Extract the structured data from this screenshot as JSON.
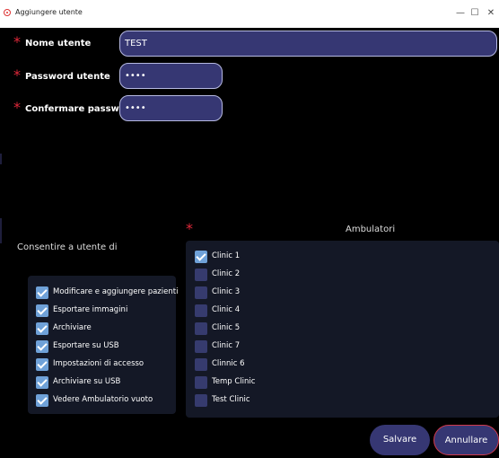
{
  "window": {
    "title": "Aggiungere utente",
    "minimize": "—",
    "maximize": "☐",
    "close": "✕"
  },
  "required_mark": "*",
  "form": {
    "username": {
      "label": "Nome utente",
      "value": "TEST"
    },
    "password": {
      "label": "Password utente",
      "value": "••••"
    },
    "confirm": {
      "label": "Confermare password",
      "value": "••••"
    }
  },
  "permissions": {
    "heading": "Consentire a utente di",
    "items": [
      {
        "label": "Modificare e aggiungere pazienti",
        "checked": true
      },
      {
        "label": "Esportare immagini",
        "checked": true
      },
      {
        "label": "Archiviare",
        "checked": true
      },
      {
        "label": "Esportare su USB",
        "checked": true
      },
      {
        "label": "Impostazioni di accesso",
        "checked": true
      },
      {
        "label": "Archiviare su USB",
        "checked": true
      },
      {
        "label": "Vedere Ambulatorio vuoto",
        "checked": true
      }
    ]
  },
  "clinics": {
    "heading": "Ambulatori",
    "items": [
      {
        "label": "Clinic 1",
        "checked": true
      },
      {
        "label": "Clinic 2",
        "checked": false
      },
      {
        "label": "Clinic 3",
        "checked": false
      },
      {
        "label": "Clinic 4",
        "checked": false
      },
      {
        "label": "Clinic 5",
        "checked": false
      },
      {
        "label": "Clinic 7",
        "checked": false
      },
      {
        "label": "Clinnic 6",
        "checked": false
      },
      {
        "label": "Temp Clinic",
        "checked": false
      },
      {
        "label": "Test Clinic",
        "checked": false
      }
    ]
  },
  "buttons": {
    "save": "Salvare",
    "cancel": "Annullare"
  }
}
